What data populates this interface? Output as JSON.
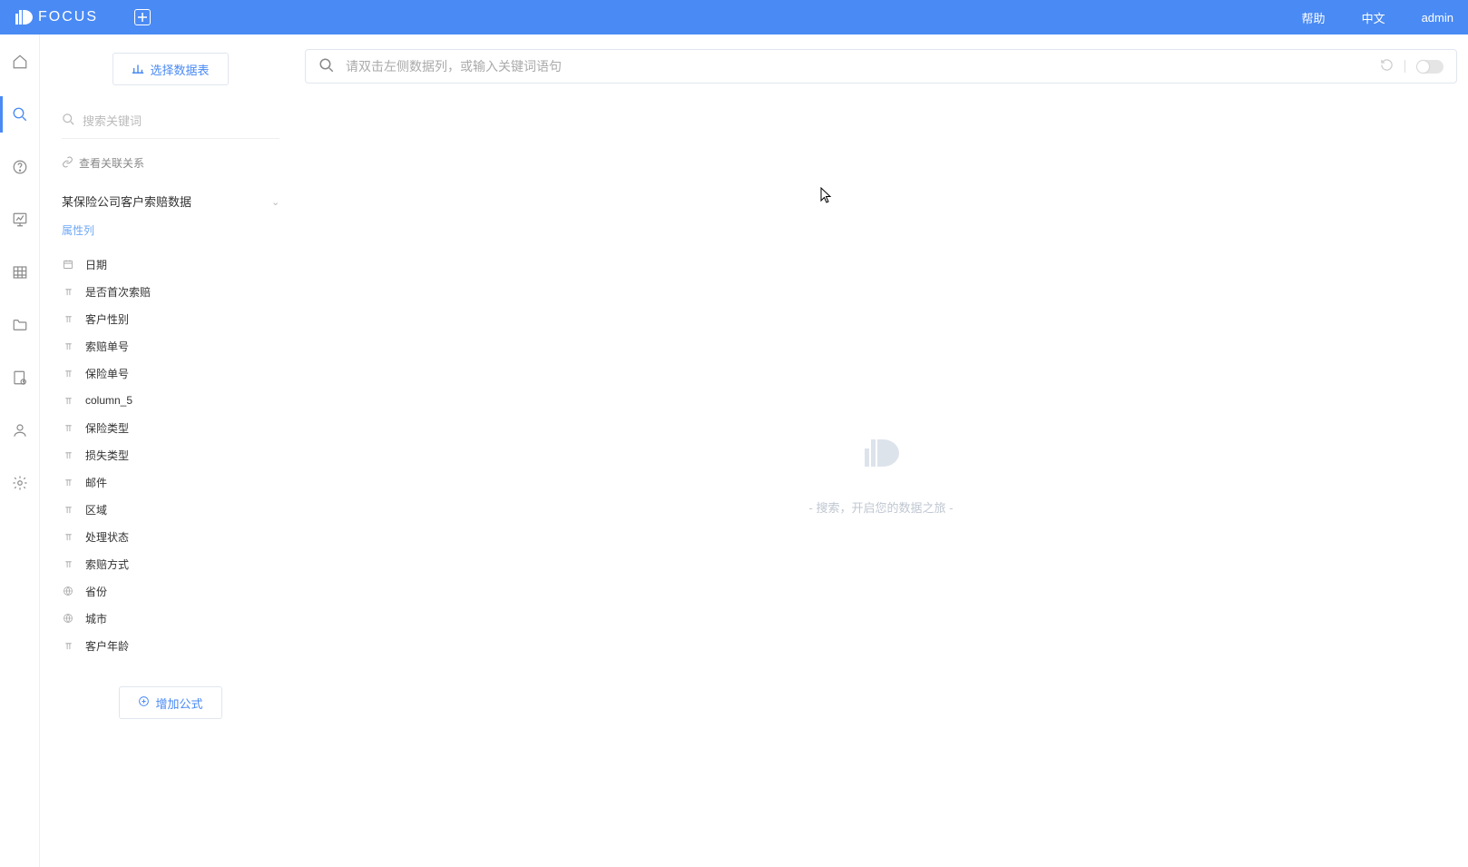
{
  "header": {
    "brand": "FOCUS",
    "help": "帮助",
    "language": "中文",
    "user": "admin"
  },
  "sidebar": {
    "select_datatable": "选择数据表",
    "keyword_placeholder": "搜索关键词",
    "view_relations": "查看关联关系",
    "dataset_title": "某保险公司客户索赔数据",
    "attr_section": "属性列",
    "columns": [
      {
        "icon": "calendar",
        "label": "日期"
      },
      {
        "icon": "text",
        "label": "是否首次索赔"
      },
      {
        "icon": "text",
        "label": "客户性别"
      },
      {
        "icon": "text",
        "label": "索赔单号"
      },
      {
        "icon": "text",
        "label": "保险单号"
      },
      {
        "icon": "text",
        "label": "column_5"
      },
      {
        "icon": "text",
        "label": "保险类型"
      },
      {
        "icon": "text",
        "label": "损失类型"
      },
      {
        "icon": "text",
        "label": "邮件"
      },
      {
        "icon": "text",
        "label": "区域"
      },
      {
        "icon": "text",
        "label": "处理状态"
      },
      {
        "icon": "text",
        "label": "索赔方式"
      },
      {
        "icon": "globe",
        "label": "省份"
      },
      {
        "icon": "globe",
        "label": "城市"
      },
      {
        "icon": "text",
        "label": "客户年龄"
      }
    ],
    "add_formula": "增加公式"
  },
  "main": {
    "search_placeholder": "请双击左侧数据列，或输入关键词语句",
    "empty_text": "- 搜索，开启您的数据之旅 -"
  }
}
